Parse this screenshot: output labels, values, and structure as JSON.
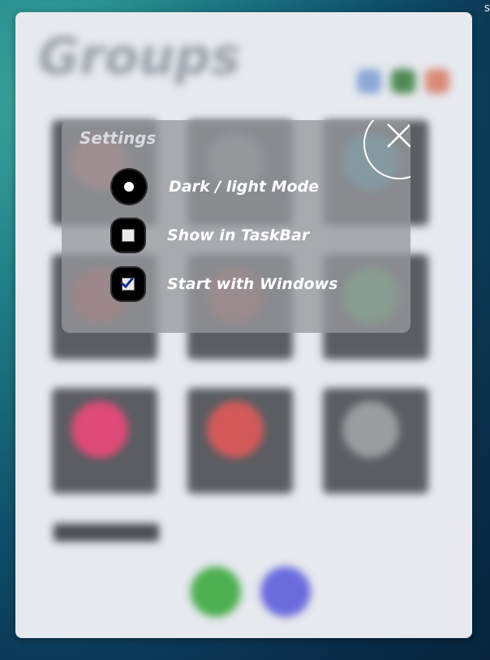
{
  "window": {
    "app_title": "Groups"
  },
  "settings": {
    "title": "Settings",
    "close_icon": "close-x-icon",
    "options": [
      {
        "label": "Dark / light Mode",
        "control": "radio",
        "checked": true
      },
      {
        "label": "Show in TaskBar",
        "control": "checkbox",
        "checked": false
      },
      {
        "label": "Start with Windows",
        "control": "checkbox",
        "checked": true
      }
    ]
  },
  "colors": {
    "panel_bg": "#96989c",
    "accent_green": "#4caf50",
    "accent_purple": "#6b6bdc",
    "dot_blue": "#8aa8d8",
    "dot_green": "#4e8a55",
    "dot_red": "#d98a78"
  },
  "fabs": [
    {
      "icon": "edit-icon",
      "color": "#4caf50"
    },
    {
      "icon": "add-icon",
      "color": "#6b6bdc"
    }
  ]
}
